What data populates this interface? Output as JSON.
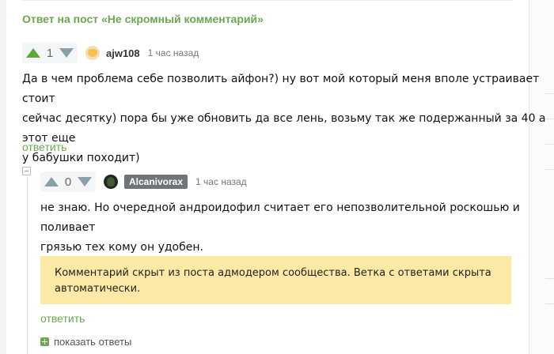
{
  "post_link": "Ответ на пост «Не скромный комментарий»",
  "comments": [
    {
      "rating": "1",
      "upvoted": true,
      "username": "ajw108",
      "time": "1 час назад",
      "lines": [
        "Да в чем проблема себе позволить айфон?) ну вот мой который меня вполе устраивает стоит",
        "сейчас десятку) пора бы уже обновить да все лень, возьму так же подержанный за 40 а этот еще",
        "у бабушки походит)"
      ],
      "reply_label": "ответить"
    },
    {
      "rating": "0",
      "upvoted": false,
      "username": "Alcanivorax",
      "time": "1 час назад",
      "lines": [
        "не знаю. Но очередной андроидофил считает его непозволительной роскошью и поливает",
        "грязью тех кому он удобен."
      ],
      "reply_label": "ответить"
    }
  ],
  "hidden_notice": {
    "lines": [
      "Комментарий скрыт из поста адмодером сообщества. Ветка с ответами скрыта",
      "автоматически."
    ]
  },
  "show_replies_label": "показать ответы",
  "colors": {
    "accent": "#6aa84f",
    "notice_bg": "#fbe9a5",
    "badge_bg": "#6f7478"
  }
}
